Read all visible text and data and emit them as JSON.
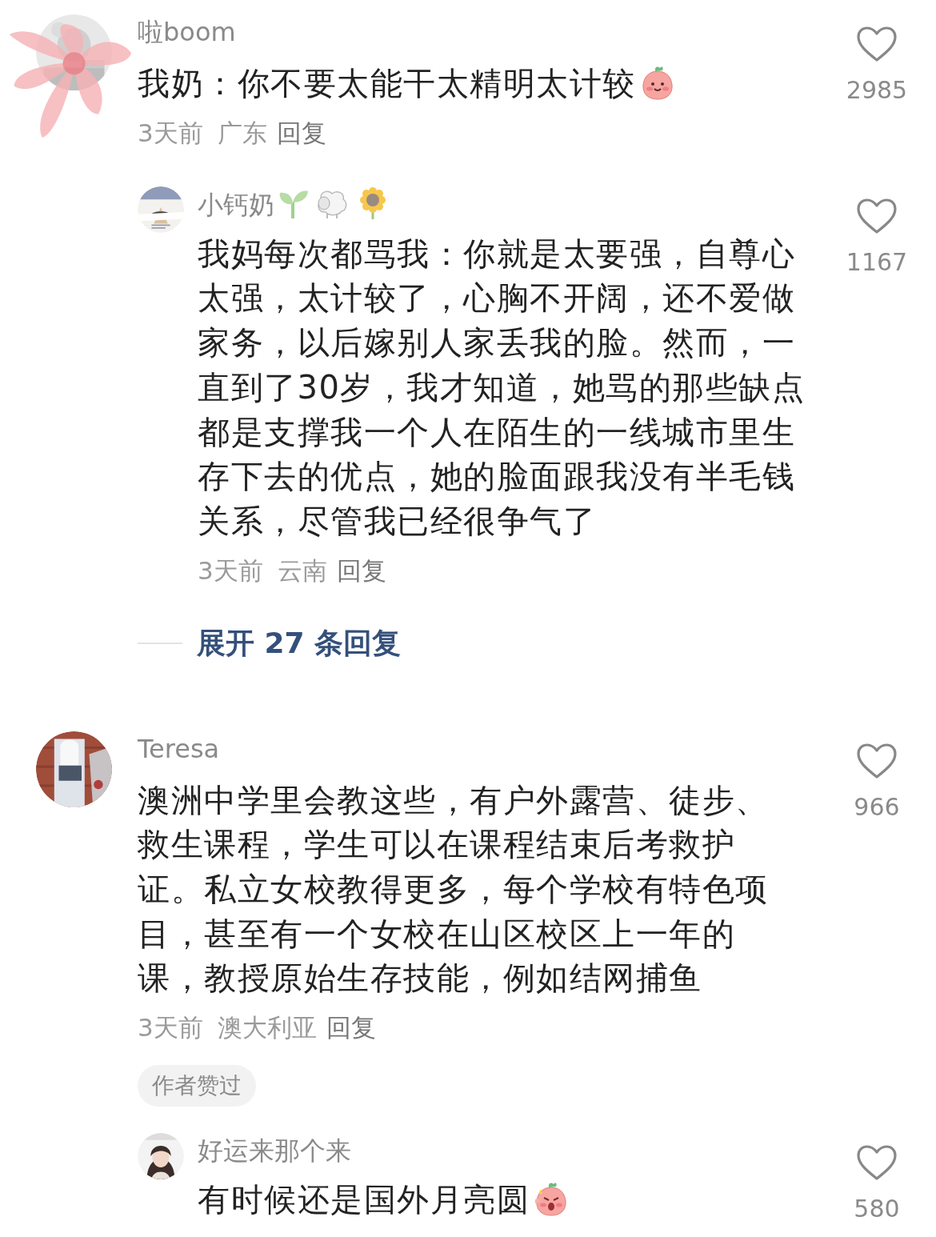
{
  "comments": [
    {
      "author": "啦boom",
      "text": "我奶：你不要太能干太精明太计较",
      "text_emoji": true,
      "time": "3天前",
      "location": "广东",
      "reply_label": "回复",
      "likes": "2985",
      "replies": [
        {
          "author": "小钙奶",
          "name_emojis": true,
          "text": "我妈每次都骂我：你就是太要强，自尊心太强，太计较了，心胸不开阔，还不爱做家务，以后嫁别人家丢我的脸。然而，一直到了30岁，我才知道，她骂的那些缺点都是支撑我一个人在陌生的一线城市里生存下去的优点，她的脸面跟我没有半毛钱关系，尽管我已经很争气了",
          "text_emoji": false,
          "time": "3天前",
          "location": "云南",
          "reply_label": "回复",
          "likes": "1167"
        }
      ],
      "expand_label": "展开 27 条回复"
    },
    {
      "author": "Teresa",
      "text": "澳洲中学里会教这些，有户外露营、徒步、救生课程，学生可以在课程结束后考救护证。私立女校教得更多，每个学校有特色项目，甚至有一个女校在山区校区上一年的课，教授原始生存技能，例如结网捕鱼",
      "text_emoji": false,
      "time": "3天前",
      "location": "澳大利亚",
      "reply_label": "回复",
      "likes": "966",
      "badge": "作者赞过",
      "replies": [
        {
          "author": "好运来那个来",
          "name_emojis": false,
          "text": "有时候还是国外月亮圆",
          "text_emoji": true,
          "likes": "580"
        }
      ]
    }
  ]
}
